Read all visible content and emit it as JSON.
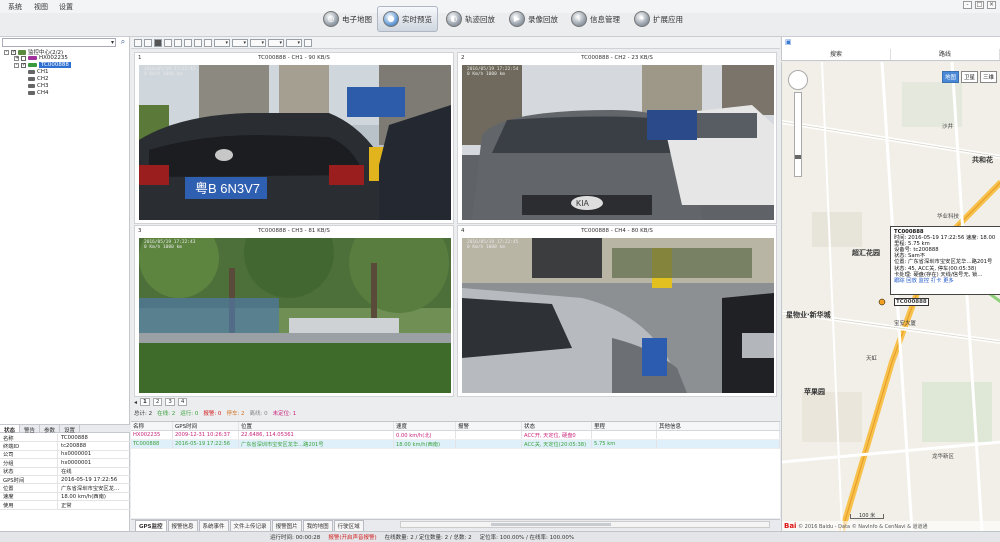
{
  "menu": {
    "items": [
      "系统",
      "视图",
      "设置"
    ]
  },
  "window_controls": [
    "-",
    "□",
    "×"
  ],
  "nav": {
    "items": [
      {
        "label": "电子地图",
        "icon": "map-icon"
      },
      {
        "label": "实时预览",
        "icon": "camera-icon",
        "active": true
      },
      {
        "label": "轨迹回放",
        "icon": "track-icon"
      },
      {
        "label": "录像回放",
        "icon": "replay-icon"
      },
      {
        "label": "信息管理",
        "icon": "info-icon"
      },
      {
        "label": "扩展应用",
        "icon": "extension-icon"
      }
    ]
  },
  "tree": {
    "root": "监控中心(2/2)",
    "vehicle1": "HX002235",
    "vehicle2": "TC000888",
    "channels": [
      "CH1",
      "CH2",
      "CH3",
      "CH4"
    ]
  },
  "info_tabs": [
    "状态",
    "警告",
    "参数",
    "设置"
  ],
  "info": [
    {
      "k": "名称",
      "v": "TC000888"
    },
    {
      "k": "终端ID",
      "v": "tc200888"
    },
    {
      "k": "公司",
      "v": "hx0000001"
    },
    {
      "k": "分组",
      "v": "hx0000001"
    },
    {
      "k": "状态",
      "v": "在线"
    },
    {
      "k": "GPS时间",
      "v": "2016-05-19 17:22:56"
    },
    {
      "k": "位置",
      "v": "广东省深圳市宝安区龙..."
    },
    {
      "k": "速度",
      "v": "18.00 km/h(西南)"
    },
    {
      "k": "使用",
      "v": "正常"
    }
  ],
  "videos": [
    {
      "num": "1",
      "title": "TC000888 - CH1 - 90 KB/S",
      "osd": "2016/05/19 17:22:42\n0 Km/h 1000 km",
      "accent": "#2f5fb0"
    },
    {
      "num": "2",
      "title": "TC000888 - CH2 - 23 KB/S",
      "osd": "2016/05/19 17:22:54\n0 Km/h 1000 km",
      "accent": "#555"
    },
    {
      "num": "3",
      "title": "TC000888 - CH3 - 81 KB/S",
      "osd": "2016/05/19 17:22:43\n0 Km/h 1000 km",
      "accent": "#3a7a3a"
    },
    {
      "num": "4",
      "title": "TC000888 - CH4 - 80 KB/S",
      "osd": "2016/05/19 17:22:45\n0 Km/h 1000 km",
      "accent": "#444"
    }
  ],
  "plates": [
    "粤B 6N3V7",
    "KIA"
  ],
  "pager": {
    "pages": [
      "1",
      "2",
      "3",
      "4"
    ]
  },
  "status_counts": [
    {
      "label": "总计: 2",
      "color": "#333"
    },
    {
      "label": "在线: 2",
      "color": "#3aa03a"
    },
    {
      "label": "运行: 0",
      "color": "#3aa03a"
    },
    {
      "label": "报警: 0",
      "color": "#d21d1d"
    },
    {
      "label": "停车: 2",
      "color": "#d07020"
    },
    {
      "label": "离线: 0",
      "color": "#888"
    },
    {
      "label": "未定位: 1",
      "color": "#c8237a"
    }
  ],
  "grid": {
    "headers": [
      "名称",
      "GPS时间",
      "位置",
      "速度",
      "报警",
      "状态",
      "里程",
      "其他信息"
    ],
    "rows": [
      [
        "HX002235",
        "2009-12-31 10:26:37",
        "22.6486, 114.05361",
        "0.00 km/h(北)",
        "",
        "ACC开, 天定位, 硬盘0",
        "",
        ""
      ],
      [
        "TC000888",
        "2016-05-19 17:22:56",
        "广东省深圳市宝安区龙华…路201号",
        "18.00 km/h(西南)",
        "",
        "ACC关, 天定位(20:05:38)",
        "5.75 km",
        ""
      ]
    ]
  },
  "bottom_tabs": [
    "GPS监控",
    "报警信息",
    "系统事件",
    "文件上传记录",
    "报警图片",
    "我的地图",
    "行驶区域"
  ],
  "global_status": {
    "runtime": "运行时间: 00:00:28",
    "alarm": "报警(开启声音报警)",
    "online": "在线数量: 2 / 定位数量: 2 / 总数: 2",
    "rate": "定位率: 100.00% / 在线率: 100.00%"
  },
  "map": {
    "tab_icon": "map-tab-icon",
    "search": [
      "搜索",
      "路线"
    ],
    "toggle": [
      "地图",
      "卫星",
      "三维"
    ],
    "labels": [
      "共和花",
      "超汇花园",
      "宝安大厦",
      "苹果园",
      "星物业·新华城",
      "沙井",
      "华业科技",
      "天虹",
      "龙华新区"
    ],
    "popup": {
      "title": "TC000888",
      "lines": [
        "时间: 2016-05-19 17:22:56   速度: 18.00",
        "里程: 5.75 km",
        "设备号: tc200888",
        "状态: Sam不",
        "位置: 广东省深圳市宝安区龙华…路201号",
        "状态: 45, ACC关, 停车(00:05:38)",
        "卡处理: 硬盘(存在) 天线/信号无, 锁…"
      ],
      "links": "跟踪 回放 监控 打卡 更多",
      "marker_label": "TC000888"
    },
    "scale": "100 米",
    "footer": "© 2016 Baidu - Data © NavInfo & CenNavi & 道道通"
  },
  "colors": {
    "accent_blue": "#2f6fd1",
    "alarm_red": "#d21d1d",
    "online_green": "#3aa03a",
    "vehicle_magenta": "#c8237a"
  }
}
